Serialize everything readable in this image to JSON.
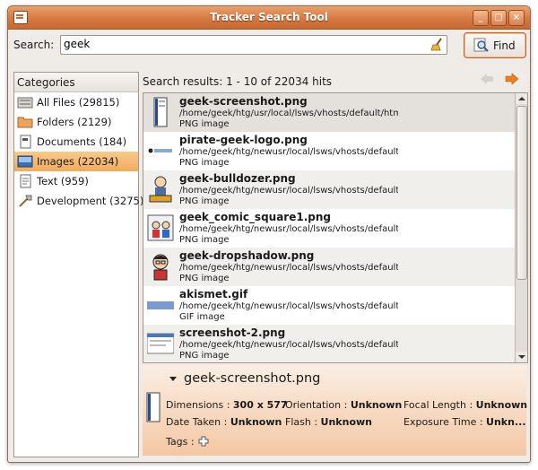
{
  "window": {
    "title": "Tracker Search Tool"
  },
  "search": {
    "label": "Search:",
    "value": "geek",
    "find_label": "Find"
  },
  "categories": {
    "header": "Categories",
    "items": [
      {
        "label": "All Files (29815)",
        "icon": "all-files-icon"
      },
      {
        "label": "Folders (2129)",
        "icon": "folder-icon"
      },
      {
        "label": "Documents (184)",
        "icon": "document-icon"
      },
      {
        "label": "Images (22034)",
        "icon": "image-icon",
        "selected": true
      },
      {
        "label": "Text (959)",
        "icon": "text-icon"
      },
      {
        "label": "Development (3275)",
        "icon": "development-icon"
      }
    ]
  },
  "results_info": "Search results: 1 - 10 of 22034 hits",
  "results": [
    {
      "name": "geek-screenshot.png",
      "path": "/home/geek/htg/usr/local/lsws/vhosts/default/html/v",
      "type": "PNG image"
    },
    {
      "name": "pirate-geek-logo.png",
      "path": "/home/geek/htg/newusr/local/lsws/vhosts/default/ht",
      "type": "PNG image"
    },
    {
      "name": "geek-bulldozer.png",
      "path": "/home/geek/htg/newusr/local/lsws/vhosts/default/ht",
      "type": "PNG image"
    },
    {
      "name": "geek_comic_square1.png",
      "path": "/home/geek/htg/newusr/local/lsws/vhosts/default/ht",
      "type": "PNG image"
    },
    {
      "name": "geek-dropshadow.png",
      "path": "/home/geek/htg/newusr/local/lsws/vhosts/default/ht",
      "type": "PNG image"
    },
    {
      "name": "akismet.gif",
      "path": "/home/geek/htg/newusr/local/lsws/vhosts/default/ht",
      "type": "GIF image"
    },
    {
      "name": "screenshot-2.png",
      "path": "/home/geek/htg/newusr/local/lsws/vhosts/default/ht",
      "type": "PNG image"
    }
  ],
  "detail": {
    "title": "geek-screenshot.png",
    "dimensions_label": "Dimensions :",
    "dimensions_value": "300 x 577",
    "orientation_label": "Orientation :",
    "orientation_value": "Unknown",
    "focal_label": "Focal Length :",
    "focal_value": "Unknown",
    "date_label": "Date Taken :",
    "date_value": "Unknown",
    "flash_label": "Flash :",
    "flash_value": "Unknown",
    "exposure_label": "Exposure Time :",
    "exposure_value": "Unkn...",
    "tags_label": "Tags :"
  },
  "colors": {
    "titlebar": "#d4763f",
    "selection": "#f1ac5c",
    "accent_arrow": "#f07d1e"
  }
}
